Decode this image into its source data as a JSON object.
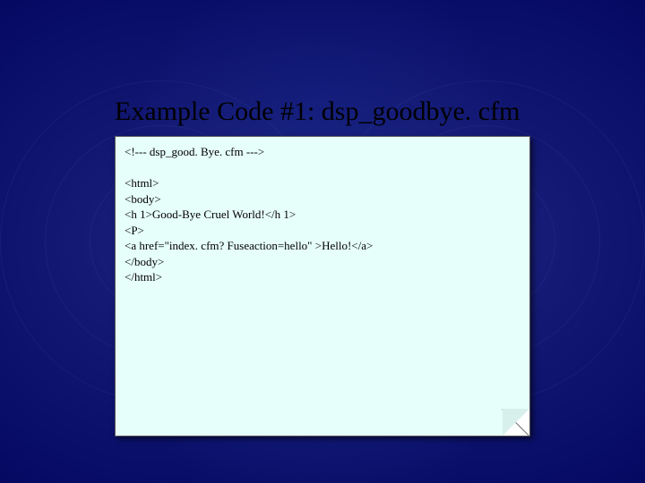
{
  "slide": {
    "title": "Example Code #1: dsp_goodbye. cfm"
  },
  "code": {
    "line1": "<!--- dsp_good. Bye. cfm --->",
    "line2": "",
    "line3": "<html>",
    "line4": "<body>",
    "line5": "<h 1>Good-Bye Cruel World!</h 1>",
    "line6": "<P>",
    "line7": "<a href=\"index. cfm? Fuseaction=hello\" >Hello!</a>",
    "line8": "</body>",
    "line9": "</html>"
  }
}
